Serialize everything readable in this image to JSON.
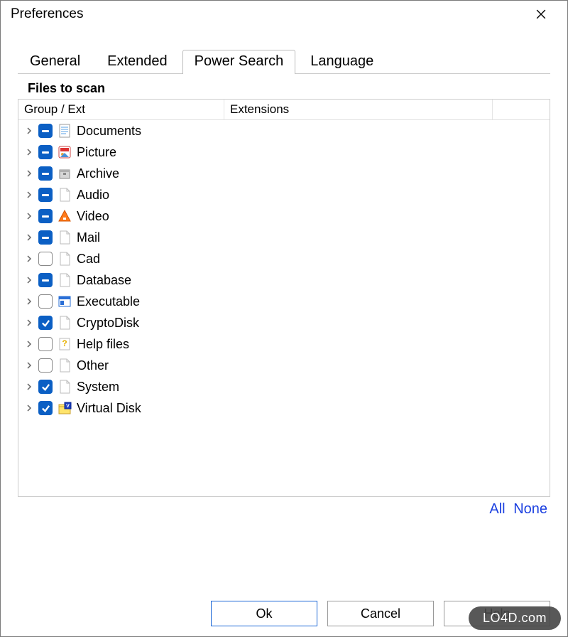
{
  "window": {
    "title": "Preferences"
  },
  "tabs": {
    "items": [
      {
        "label": "General",
        "active": false
      },
      {
        "label": "Extended",
        "active": false
      },
      {
        "label": "Power Search",
        "active": true
      },
      {
        "label": "Language",
        "active": false
      }
    ]
  },
  "section_title": "Files to scan",
  "tree": {
    "headers": {
      "group": "Group / Ext",
      "ext": "Extensions"
    },
    "rows": [
      {
        "label": "Documents",
        "state": "mixed",
        "icon": "doc"
      },
      {
        "label": "Picture",
        "state": "mixed",
        "icon": "picture"
      },
      {
        "label": "Archive",
        "state": "mixed",
        "icon": "archive"
      },
      {
        "label": "Audio",
        "state": "mixed",
        "icon": "file"
      },
      {
        "label": "Video",
        "state": "mixed",
        "icon": "video"
      },
      {
        "label": "Mail",
        "state": "mixed",
        "icon": "file"
      },
      {
        "label": "Cad",
        "state": "unchecked",
        "icon": "file"
      },
      {
        "label": "Database",
        "state": "mixed",
        "icon": "file"
      },
      {
        "label": "Executable",
        "state": "unchecked",
        "icon": "exe"
      },
      {
        "label": "CryptoDisk",
        "state": "checked",
        "icon": "file"
      },
      {
        "label": "Help files",
        "state": "unchecked",
        "icon": "help"
      },
      {
        "label": "Other",
        "state": "unchecked",
        "icon": "file"
      },
      {
        "label": "System",
        "state": "checked",
        "icon": "file"
      },
      {
        "label": "Virtual Disk",
        "state": "checked",
        "icon": "vdisk"
      }
    ]
  },
  "links": {
    "all": "All",
    "none": "None"
  },
  "buttons": {
    "ok": "Ok",
    "cancel": "Cancel",
    "help": "Help"
  },
  "watermark": "LO4D.com"
}
